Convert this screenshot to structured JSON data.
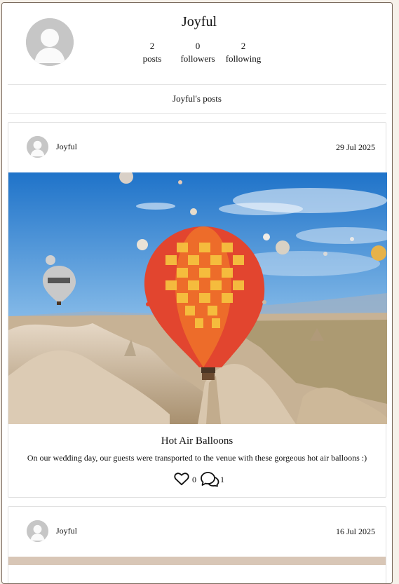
{
  "profile": {
    "username": "Joyful",
    "stats": [
      {
        "value": "2",
        "label": "posts"
      },
      {
        "value": "0",
        "label": "followers"
      },
      {
        "value": "2",
        "label": "following"
      }
    ],
    "posts_heading": "Joyful's posts"
  },
  "posts": [
    {
      "author": "Joyful",
      "date": "29 Jul 2025",
      "title": "Hot Air Balloons",
      "caption": "On our wedding day, our guests were transported to the venue with these gorgeous hot air balloons :)",
      "likes": "0",
      "comments": "1"
    },
    {
      "author": "Joyful",
      "date": "16 Jul 2025"
    }
  ],
  "icons": {
    "avatar": "default-user-avatar-icon",
    "like": "heart-outline-icon",
    "comment": "speech-bubbles-outline-icon"
  }
}
